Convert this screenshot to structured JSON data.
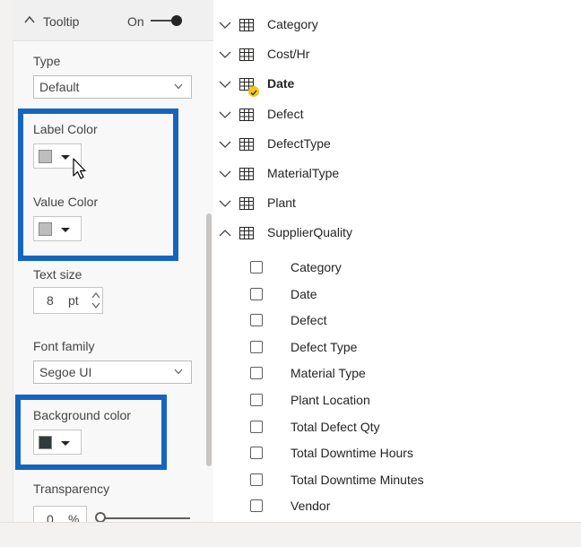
{
  "format_pane": {
    "section": {
      "title": "Tooltip",
      "toggle_label": "On",
      "toggle_state": "on",
      "expanded": true
    },
    "type_label": "Type",
    "type_value": "Default",
    "label_color_label": "Label Color",
    "label_color_swatch": "#bdbdbd",
    "value_color_label": "Value Color",
    "value_color_swatch": "#bdbdbd",
    "text_size_label": "Text size",
    "text_size_value": "8",
    "text_size_unit": "pt",
    "font_family_label": "Font family",
    "font_family_value": "Segoe UI",
    "background_color_label": "Background color",
    "background_color_swatch": "#2f3b3b",
    "transparency_label": "Transparency",
    "transparency_value": "0",
    "transparency_unit": "%",
    "highlight_color": "#1565c0"
  },
  "fields_pane": {
    "tables": [
      {
        "name": "Category",
        "expanded": false,
        "bold": false,
        "has_badge": false
      },
      {
        "name": "Cost/Hr",
        "expanded": false,
        "bold": false,
        "has_badge": false
      },
      {
        "name": "Date",
        "expanded": false,
        "bold": true,
        "has_badge": true
      },
      {
        "name": "Defect",
        "expanded": false,
        "bold": false,
        "has_badge": false
      },
      {
        "name": "DefectType",
        "expanded": false,
        "bold": false,
        "has_badge": false
      },
      {
        "name": "MaterialType",
        "expanded": false,
        "bold": false,
        "has_badge": false
      },
      {
        "name": "Plant",
        "expanded": false,
        "bold": false,
        "has_badge": false
      },
      {
        "name": "SupplierQuality",
        "expanded": true,
        "bold": false,
        "has_badge": false
      }
    ],
    "supplier_quality_fields": [
      "Category",
      "Date",
      "Defect",
      "Defect Type",
      "Material Type",
      "Plant Location",
      "Total Defect Qty",
      "Total Downtime Hours",
      "Total Downtime Minutes",
      "Vendor"
    ],
    "badge_color": "#f2c811"
  }
}
